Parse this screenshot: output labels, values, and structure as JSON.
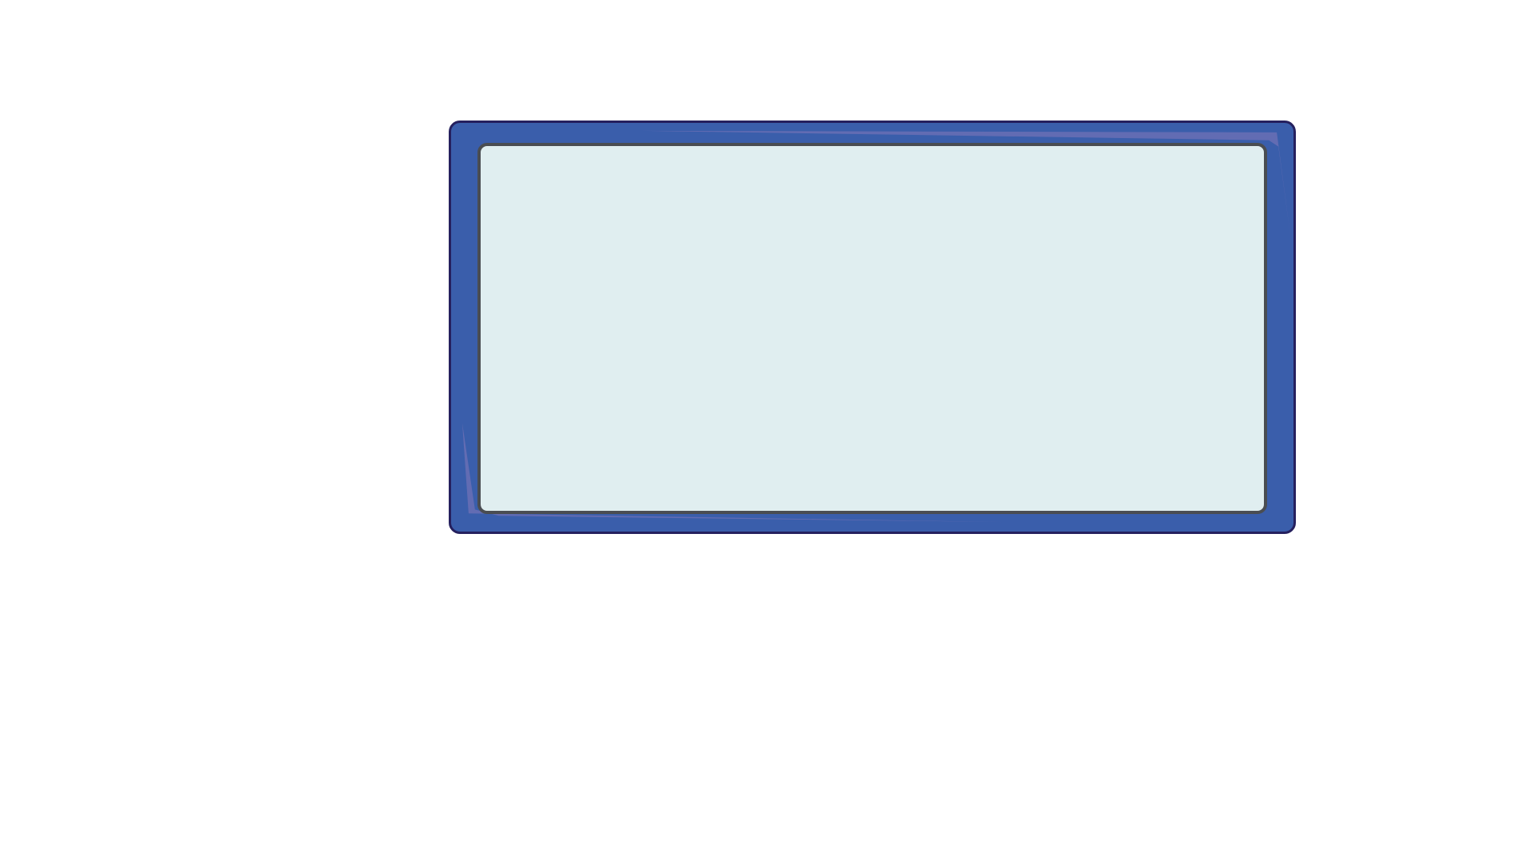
{
  "colors": {
    "background": "#ffffff",
    "frame_fill": "#3a5eab",
    "frame_outline": "#25205e",
    "frame_highlight": "#6a6fb4",
    "screen_fill": "#e0eef0",
    "screen_outline": "#4a4d52"
  }
}
